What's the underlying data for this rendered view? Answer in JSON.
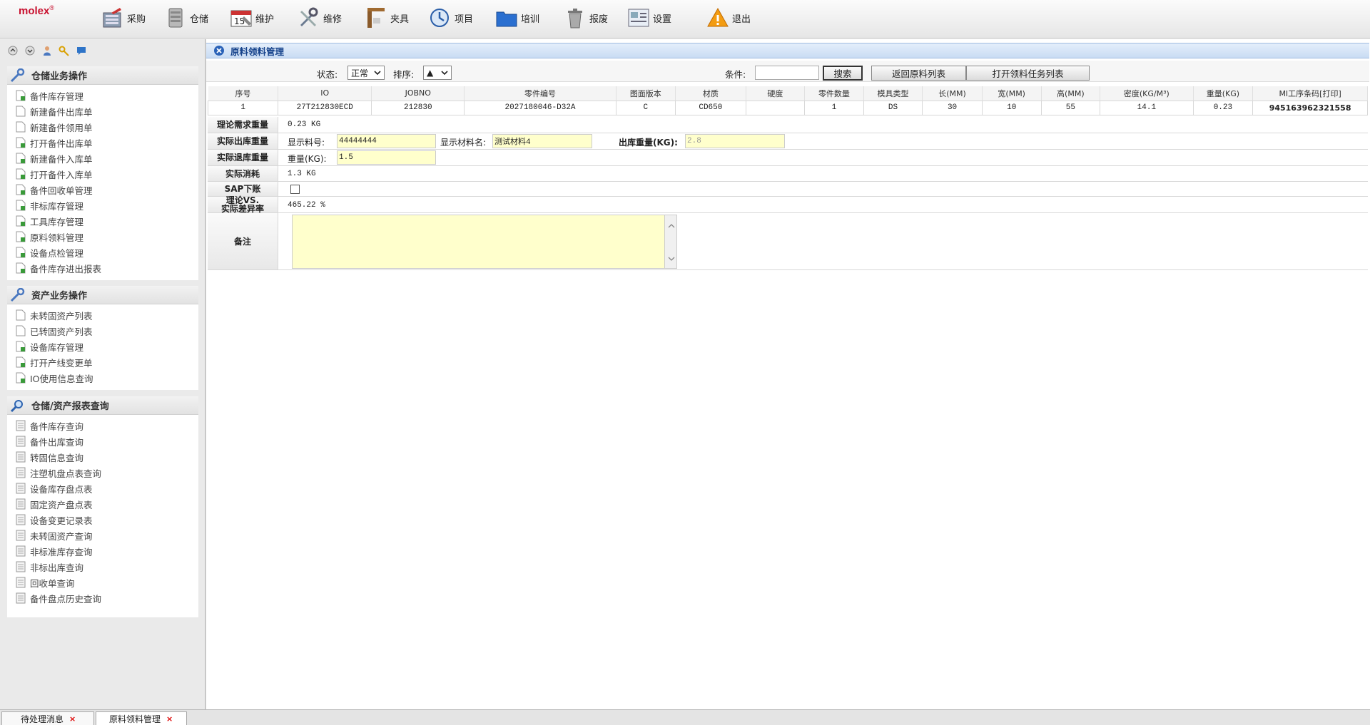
{
  "brand": {
    "logo": "molex",
    "reg": "®"
  },
  "toolbar": [
    {
      "label": "采购",
      "icon": "purchase-icon"
    },
    {
      "label": "仓储",
      "icon": "server-icon"
    },
    {
      "label": "维护",
      "icon": "calendar-icon"
    },
    {
      "label": "维修",
      "icon": "tools-icon"
    },
    {
      "label": "夹具",
      "icon": "fixture-icon"
    },
    {
      "label": "项目",
      "icon": "project-icon"
    },
    {
      "label": "培训",
      "icon": "folder-icon"
    },
    {
      "label": "报废",
      "icon": "trash-icon"
    },
    {
      "label": "设置",
      "icon": "settings-icon"
    },
    {
      "label": "退出",
      "icon": "warning-icon"
    }
  ],
  "sidebar": {
    "sections": [
      {
        "title": "仓储业务操作",
        "items": [
          "备件库存管理",
          "新建备件出库单",
          "新建备件领用单",
          "打开备件出库单",
          "新建备件入库单",
          "打开备件入库单",
          "备件回收单管理",
          "非标库存管理",
          "工具库存管理",
          "原料领料管理",
          "设备点检管理",
          "备件库存进出报表"
        ]
      },
      {
        "title": "资产业务操作",
        "items": [
          "未转固资产列表",
          "已转固资产列表",
          "设备库存管理",
          "打开产线变更单",
          "IO使用信息查询"
        ]
      },
      {
        "title": "仓储/资产报表查询",
        "items": [
          "备件库存查询",
          "备件出库查询",
          "转固信息查询",
          "注塑机盘点表查询",
          "设备库存盘点表",
          "固定资产盘点表",
          "设备变更记录表",
          "未转固资产查询",
          "非标准库存查询",
          "非标出库查询",
          "回收单查询",
          "备件盘点历史查询"
        ]
      }
    ]
  },
  "panel": {
    "title": "原料领料管理"
  },
  "filter": {
    "status_label": "状态:",
    "status_value": "正常",
    "sort_label": "排序:",
    "sort_value": "▲",
    "cond_label": "条件:",
    "cond_value": "",
    "search_btn": "搜索",
    "back_btn": "返回原料列表",
    "open_btn": "打开领料任务列表"
  },
  "table": {
    "headers": [
      "序号",
      "IO",
      "JOBNO",
      "零件编号",
      "图面版本",
      "材质",
      "硬度",
      "零件数量",
      "模具类型",
      "长(MM)",
      "宽(MM)",
      "高(MM)",
      "密度(KG/M³)",
      "重量(KG)",
      "MI工序条码[打印]"
    ],
    "rows": [
      [
        "1",
        "27T212830ECD",
        "212830",
        "2027180046-D32A",
        "C",
        "CD650",
        "",
        "1",
        "DS",
        "30",
        "10",
        "55",
        "14.1",
        "0.23",
        "945163962321558"
      ]
    ]
  },
  "form": {
    "theory_label": "理论需求重量",
    "theory_value": "0.23 KG",
    "actual_out_label": "实际出库重量",
    "mat_no_label": "显示料号:",
    "mat_no_value": "44444444",
    "mat_name_label": "显示材料名:",
    "mat_name_value": "测试材料4",
    "out_weight_label": "出库重量(KG):",
    "out_weight_value": "2.8",
    "return_label": "实际退库重量",
    "weight_label": "重量(KG):",
    "weight_value": "1.5",
    "consume_label": "实际消耗",
    "consume_value": "1.3 KG",
    "sap_label": "SAP下账",
    "diff_label1": "理论VS.",
    "diff_label2": "实际差异率",
    "diff_value": "465.22 %",
    "remark_label": "备注",
    "remark_value": ""
  },
  "bottom_tabs": [
    {
      "label": "待处理消息",
      "close": "×"
    },
    {
      "label": "原料领料管理",
      "close": "×"
    }
  ]
}
